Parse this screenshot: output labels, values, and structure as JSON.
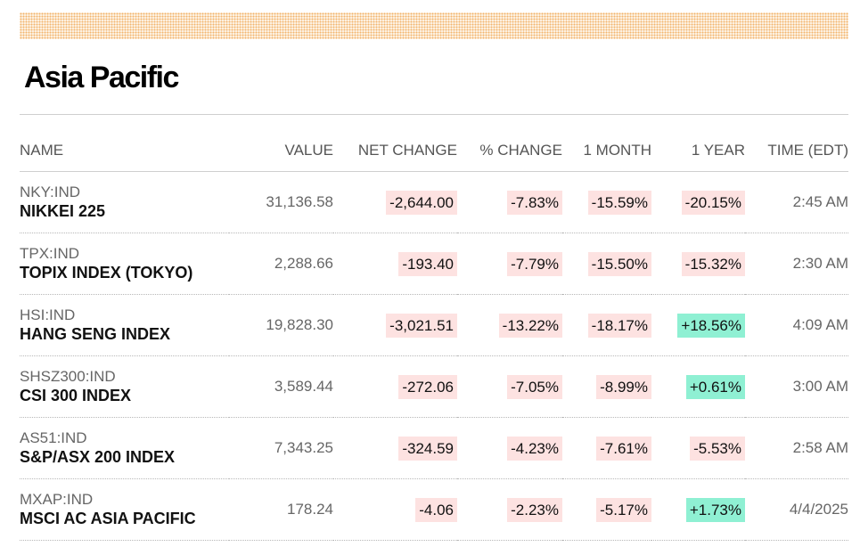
{
  "section": {
    "title": "Asia Pacific"
  },
  "colors": {
    "negative_bg": "#fde2e1",
    "positive_bg": "#8ff0d3",
    "dots_band": "#f2b56e"
  },
  "table": {
    "headers": {
      "name": "NAME",
      "value": "VALUE",
      "net_change": "NET CHANGE",
      "pct_change": "% CHANGE",
      "one_month": "1 MONTH",
      "one_year": "1 YEAR",
      "time": "TIME (EDT)"
    },
    "rows": [
      {
        "ticker": "NKY:IND",
        "name": "NIKKEI 225",
        "value": "31,136.58",
        "net_change": "-2,644.00",
        "pct_change": "-7.83%",
        "one_month": "-15.59%",
        "one_year": "-20.15%",
        "time": "2:45 AM"
      },
      {
        "ticker": "TPX:IND",
        "name": "TOPIX INDEX (TOKYO)",
        "value": "2,288.66",
        "net_change": "-193.40",
        "pct_change": "-7.79%",
        "one_month": "-15.50%",
        "one_year": "-15.32%",
        "time": "2:30 AM"
      },
      {
        "ticker": "HSI:IND",
        "name": "HANG SENG INDEX",
        "value": "19,828.30",
        "net_change": "-3,021.51",
        "pct_change": "-13.22%",
        "one_month": "-18.17%",
        "one_year": "+18.56%",
        "time": "4:09 AM"
      },
      {
        "ticker": "SHSZ300:IND",
        "name": "CSI 300 INDEX",
        "value": "3,589.44",
        "net_change": "-272.06",
        "pct_change": "-7.05%",
        "one_month": "-8.99%",
        "one_year": "+0.61%",
        "time": "3:00 AM"
      },
      {
        "ticker": "AS51:IND",
        "name": "S&P/ASX 200 INDEX",
        "value": "7,343.25",
        "net_change": "-324.59",
        "pct_change": "-4.23%",
        "one_month": "-7.61%",
        "one_year": "-5.53%",
        "time": "2:58 AM"
      },
      {
        "ticker": "MXAP:IND",
        "name": "MSCI AC ASIA PACIFIC",
        "value": "178.24",
        "net_change": "-4.06",
        "pct_change": "-2.23%",
        "one_month": "-5.17%",
        "one_year": "+1.73%",
        "time": "4/4/2025"
      }
    ]
  }
}
